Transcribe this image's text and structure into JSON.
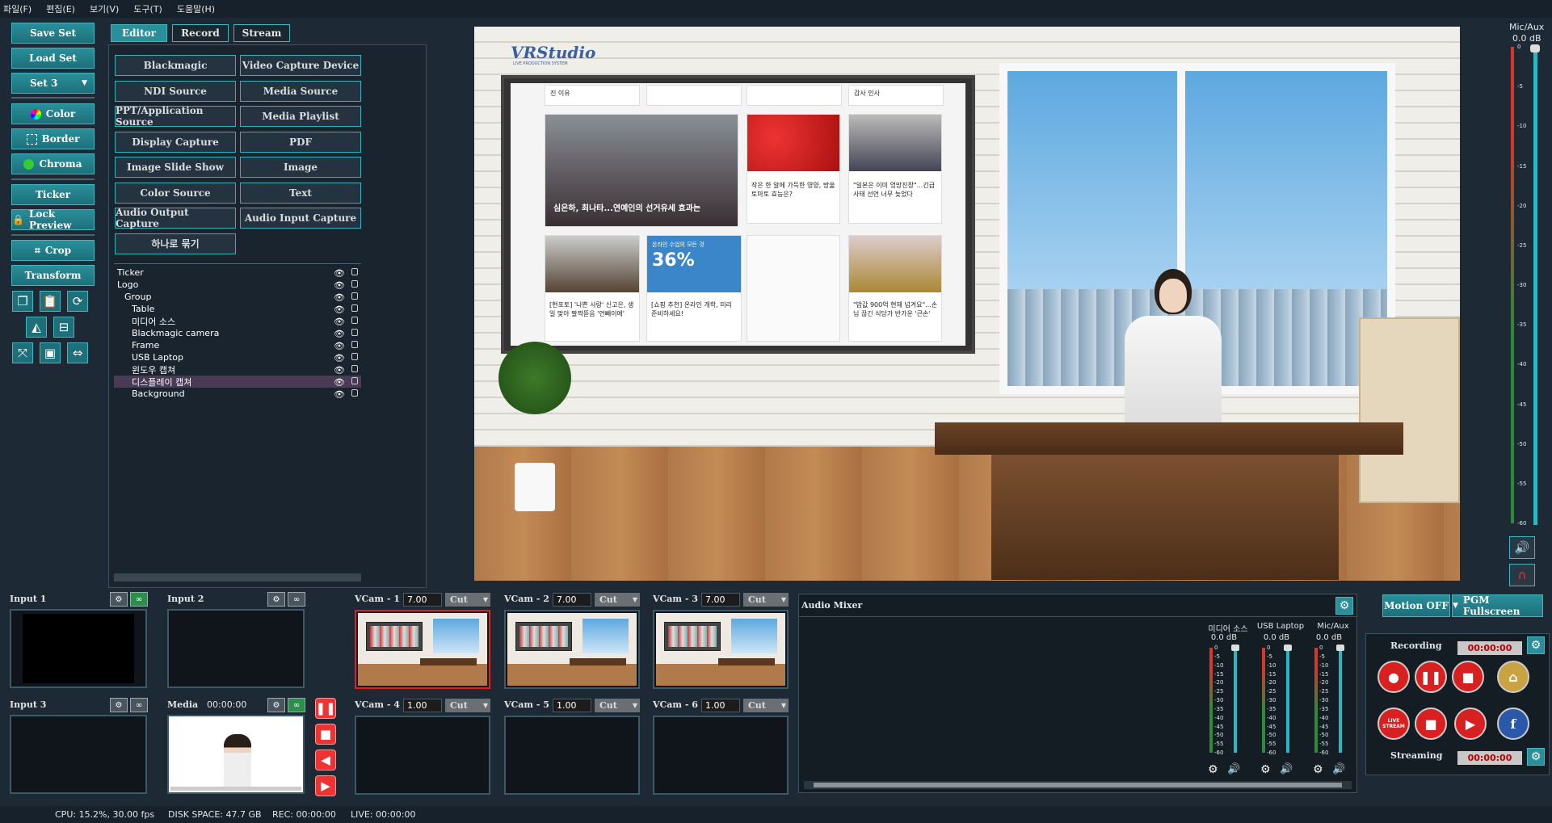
{
  "menu": [
    "파일(F)",
    "편집(E)",
    "보기(V)",
    "도구(T)",
    "도움말(H)"
  ],
  "left_buttons": {
    "save_set": "Save Set",
    "load_set": "Load Set",
    "set_select": "Set 3",
    "color": "Color",
    "border": "Border",
    "chroma": "Chroma",
    "ticker": "Ticker",
    "lock_preview": "Lock Preview",
    "crop": "Crop",
    "transform": "Transform"
  },
  "tabs": [
    "Editor",
    "Record",
    "Stream"
  ],
  "sources": [
    "Blackmagic",
    "Video Capture Device",
    "NDI Source",
    "Media Source",
    "PPT/Application Source",
    "Media Playlist",
    "Display Capture",
    "PDF",
    "Image Slide Show",
    "Image",
    "Color Source",
    "Text",
    "Audio Output Capture",
    "Audio Input Capture",
    "하나로 묶기"
  ],
  "layers": [
    {
      "name": "Ticker",
      "indent": 0
    },
    {
      "name": "Logo",
      "indent": 0
    },
    {
      "name": "Group",
      "indent": 1
    },
    {
      "name": "Table",
      "indent": 2
    },
    {
      "name": "미디어 소스",
      "indent": 2
    },
    {
      "name": "Blackmagic camera",
      "indent": 2
    },
    {
      "name": "Frame",
      "indent": 2
    },
    {
      "name": "USB Laptop",
      "indent": 2
    },
    {
      "name": "윈도우 캡쳐",
      "indent": 2
    },
    {
      "name": "디스플레이 캡쳐",
      "indent": 2,
      "selected": true
    },
    {
      "name": "Background",
      "indent": 2
    }
  ],
  "preview": {
    "logo": "VRStudio",
    "logo_sub": "LIVE PRODUCTION SYSTEM",
    "news": {
      "headline_main": "심은하, 최나타...연예인의 선거유세 효과는",
      "h1": "진 이유",
      "h2": "감사 인사",
      "h3": "작은 한 알에 가득한 영양, 방울토마토 효능은?",
      "h4": "\"일본은 이미 엉망진창\"...긴급사태 선언 너무 늦었다",
      "h5": "[현포토] '나쁜 사랑' 신고은, 생일 맞아 팔짝뜯음 '언빼이에'",
      "h6": "[쇼핑 추천] 온라인 개학, 미리 준비하세요!",
      "h7": "\"밥값 900억 현재 넘겨요\"...손님 끊긴 식당가 반가운 '큰손'",
      "percent": "36%",
      "promo": "온라인 수업의 모든 것"
    }
  },
  "mic_aux": {
    "label": "Mic/Aux",
    "db": "0.0 dB",
    "scale": [
      "0",
      "-5",
      "-10",
      "-15",
      "-20",
      "-25",
      "-30",
      "-35",
      "-40",
      "-45",
      "-50",
      "-55",
      "-60"
    ]
  },
  "inputs": [
    {
      "label": "Input 1"
    },
    {
      "label": "Input 2"
    },
    {
      "label": "Input 3"
    },
    {
      "label": "Media",
      "time": "00:00:00"
    }
  ],
  "vcams": [
    {
      "label": "VCam - 1",
      "value": "7.00",
      "mode": "Cut"
    },
    {
      "label": "VCam - 2",
      "value": "7.00",
      "mode": "Cut"
    },
    {
      "label": "VCam - 3",
      "value": "7.00",
      "mode": "Cut"
    },
    {
      "label": "VCam - 4",
      "value": "1.00",
      "mode": "Cut"
    },
    {
      "label": "VCam - 5",
      "value": "1.00",
      "mode": "Cut"
    },
    {
      "label": "VCam - 6",
      "value": "1.00",
      "mode": "Cut"
    }
  ],
  "mixer": {
    "title": "Audio Mixer",
    "channels": [
      {
        "name": "미디어 소스",
        "db": "0.0 dB"
      },
      {
        "name": "USB Laptop",
        "db": "0.0 dB"
      },
      {
        "name": "Mic/Aux",
        "db": "0.0 dB"
      }
    ],
    "scale": [
      "0",
      "-5",
      "-10",
      "-15",
      "-20",
      "-25",
      "-30",
      "-35",
      "-40",
      "-45",
      "-50",
      "-55",
      "-60"
    ]
  },
  "right": {
    "motion": "Motion OFF",
    "pgm": "PGM Fullscreen",
    "recording": "Recording",
    "rec_time": "00:00:00",
    "streaming": "Streaming",
    "stream_time": "00:00:00",
    "live_stream": "LIVE STREAM"
  },
  "status": {
    "cpu": "CPU: 15.2%, 30.00 fps",
    "disk": "DISK SPACE: 47.7 GB",
    "rec": "REC: 00:00:00",
    "live": "LIVE: 00:00:00"
  }
}
